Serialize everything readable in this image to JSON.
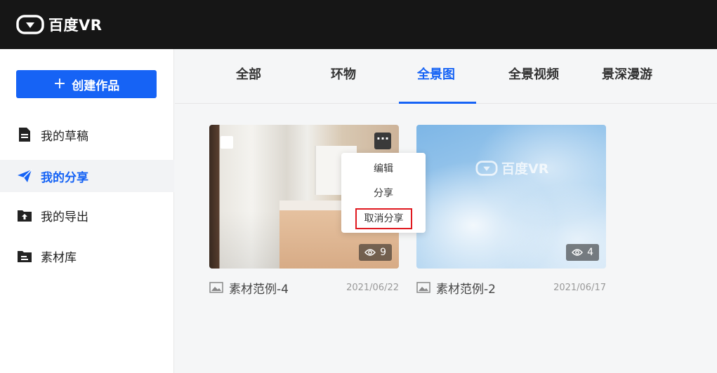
{
  "app": {
    "brand": "百度VR"
  },
  "sidebar": {
    "create_label": "创建作品",
    "items": [
      {
        "label": "我的草稿"
      },
      {
        "label": "我的分享"
      },
      {
        "label": "我的导出"
      },
      {
        "label": "素材库"
      }
    ]
  },
  "tabs": [
    "全部",
    "环物",
    "全景图",
    "全景视频",
    "景深漫游"
  ],
  "cards": [
    {
      "title": "素材范例-4",
      "date": "2021/06/22",
      "views": "9"
    },
    {
      "title": "素材范例-2",
      "date": "2021/06/17",
      "views": "4",
      "watermark": "百度VR"
    }
  ],
  "menu": {
    "items": [
      "编辑",
      "分享",
      "取消分享"
    ]
  },
  "colors": {
    "accent": "#1663f5",
    "topbar": "#161616",
    "highlight_border": "#e0191f"
  }
}
